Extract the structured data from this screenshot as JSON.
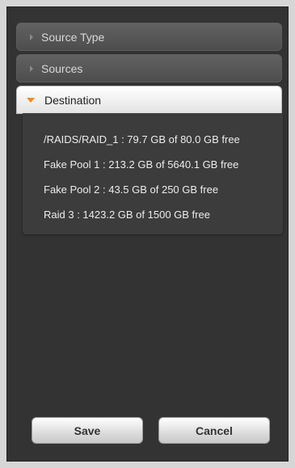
{
  "accordion": {
    "sections": [
      {
        "label": "Source Type",
        "expanded": false
      },
      {
        "label": "Sources",
        "expanded": false
      },
      {
        "label": "Destination",
        "expanded": true
      }
    ]
  },
  "destination": {
    "items": [
      "/RAIDS/RAID_1 : 79.7 GB of 80.0 GB free",
      "Fake Pool 1 : 213.2 GB of 5640.1 GB free",
      "Fake Pool 2 : 43.5 GB of 250 GB free",
      "Raid 3 : 1423.2 GB of 1500 GB free"
    ]
  },
  "buttons": {
    "save_label": "Save",
    "cancel_label": "Cancel"
  },
  "colors": {
    "panel_background": "#333333",
    "expanded_arrow": "#f28a1a"
  }
}
